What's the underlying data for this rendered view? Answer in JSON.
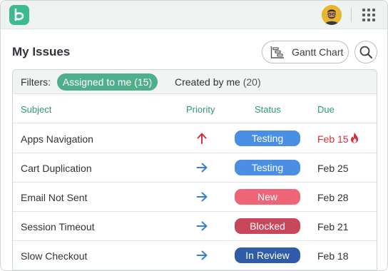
{
  "app": {
    "logo_letter": "b"
  },
  "header": {
    "title": "My Issues",
    "gantt_label": "Gantt Chart"
  },
  "filters": {
    "label": "Filters:",
    "active": {
      "label": "Assigned to me",
      "count": "(15)"
    },
    "other": {
      "label": "Created by me",
      "count": "(20)"
    }
  },
  "table": {
    "columns": {
      "subject": "Subject",
      "priority": "Priority",
      "status": "Status",
      "due": "Due"
    },
    "rows": [
      {
        "subject": "Apps Navigation",
        "priority": "up-arrow-icon",
        "status": "Testing",
        "due": "Feb 15",
        "overdue": true
      },
      {
        "subject": "Cart Duplication",
        "priority": "right-arrow-icon",
        "status": "Testing",
        "due": "Feb 25",
        "overdue": false
      },
      {
        "subject": "Email Not Sent",
        "priority": "right-arrow-icon",
        "status": "New",
        "due": "Feb 28",
        "overdue": false
      },
      {
        "subject": "Session Timeout",
        "priority": "right-arrow-icon",
        "status": "Blocked",
        "due": "Feb 21",
        "overdue": false
      },
      {
        "subject": "Slow Checkout",
        "priority": "right-arrow-icon",
        "status": "In Review",
        "due": "Feb 18",
        "overdue": false
      }
    ]
  },
  "colors": {
    "brand": "#3dba8f",
    "accent": "#4fae8b",
    "header_text": "#2f9a70",
    "status_testing": "#4a8fe3",
    "status_new": "#f06478",
    "status_blocked": "#c9475a",
    "status_in_review": "#2e5ca8",
    "priority_high": "#d6303a",
    "priority_normal": "#3a7dc9",
    "overdue": "#d6303a"
  }
}
